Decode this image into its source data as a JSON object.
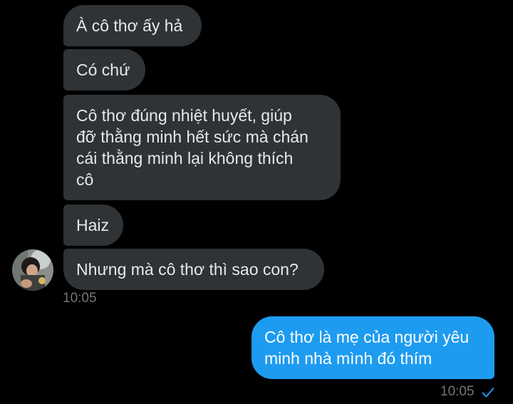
{
  "colors": {
    "background": "#000000",
    "received_bubble": "#2f3336",
    "sent_bubble": "#1d9bf0",
    "timestamp": "#71767b"
  },
  "messages": {
    "received": [
      {
        "text": "À cô thơ ấy hả"
      },
      {
        "text": "Có chứ"
      },
      {
        "text": "Cô thơ đúng nhiệt huyết, giúp\nđỡ thằng minh hết sức mà chán\ncái thằng minh lại không thích\ncô"
      },
      {
        "text": "Haiz"
      },
      {
        "text": "Nhưng mà cô thơ thì sao con?"
      }
    ],
    "received_time": "10:05",
    "sent": [
      {
        "text": "Cô thơ là mẹ của người yêu\nminh nhà mình đó thím"
      }
    ],
    "sent_time": "10:05",
    "sent_status_icon": "check-icon"
  },
  "contact": {
    "avatar_icon": "avatar-photo"
  }
}
